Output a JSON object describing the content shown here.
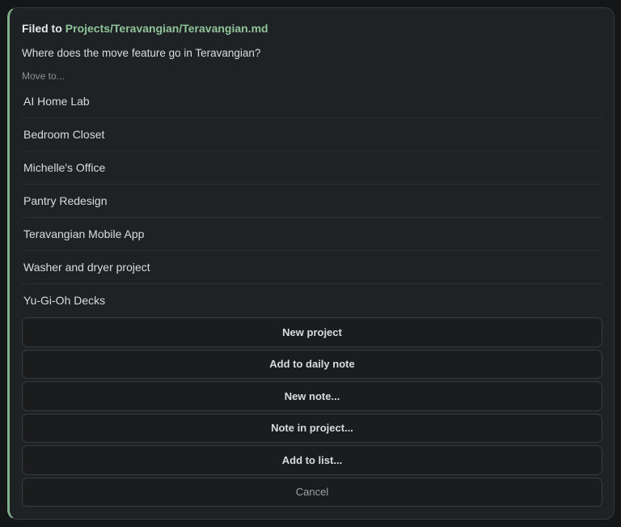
{
  "header": {
    "prefix": "Filed to",
    "path": "Projects/Teravangian/Teravangian.md"
  },
  "question": "Where does the move feature go in Teravangian?",
  "move_label": "Move to...",
  "projects": [
    "AI Home Lab",
    "Bedroom Closet",
    "Michelle's Office",
    "Pantry Redesign",
    "Teravangian Mobile App",
    "Washer and dryer project",
    "Yu-Gi-Oh Decks"
  ],
  "actions": {
    "new_project": "New project",
    "add_daily_note": "Add to daily note",
    "new_note": "New note...",
    "note_in_project": "Note in project...",
    "add_to_list": "Add to list...",
    "cancel": "Cancel"
  },
  "colors": {
    "accent": "#7fb08a",
    "path_text": "#8fc49a",
    "panel_bg": "#1f2224"
  }
}
